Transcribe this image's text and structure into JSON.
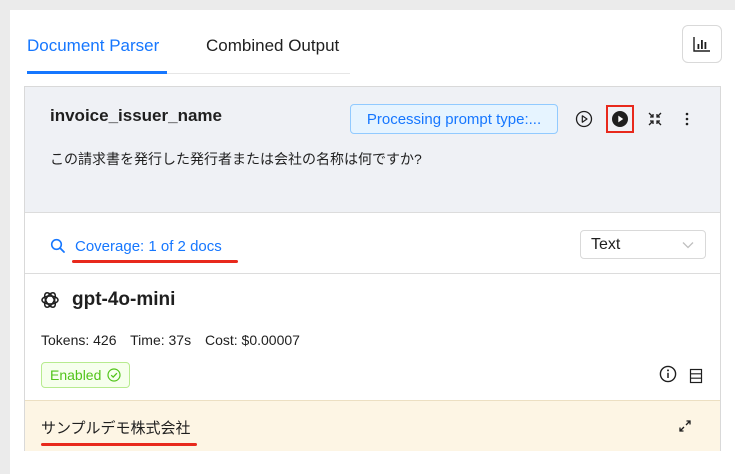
{
  "tabs": [
    {
      "label": "Document Parser",
      "active": true
    },
    {
      "label": "Combined Output",
      "active": false
    }
  ],
  "toolbar": {
    "chart_icon": "bar-chart-icon"
  },
  "prompt": {
    "name": "invoice_issuer_name",
    "status": "Processing prompt type:...",
    "text": "この請求書を発行した発行者または会社の名称は何ですか?"
  },
  "coverage": {
    "label": "Coverage: 1 of 2 docs",
    "format_value": "Text"
  },
  "model": {
    "name": "gpt-4o-mini",
    "tokens": "Tokens: 426",
    "time": "Time: 37s",
    "cost": "Cost: $0.00007",
    "enabled_label": "Enabled"
  },
  "result": {
    "text": "サンプルデモ株式会社"
  },
  "colors": {
    "accent": "#1677ff",
    "highlight_red": "#e8291c",
    "success": "#52c41a",
    "result_bg": "#fdf5e4",
    "prompt_bg": "#eff1f5"
  }
}
